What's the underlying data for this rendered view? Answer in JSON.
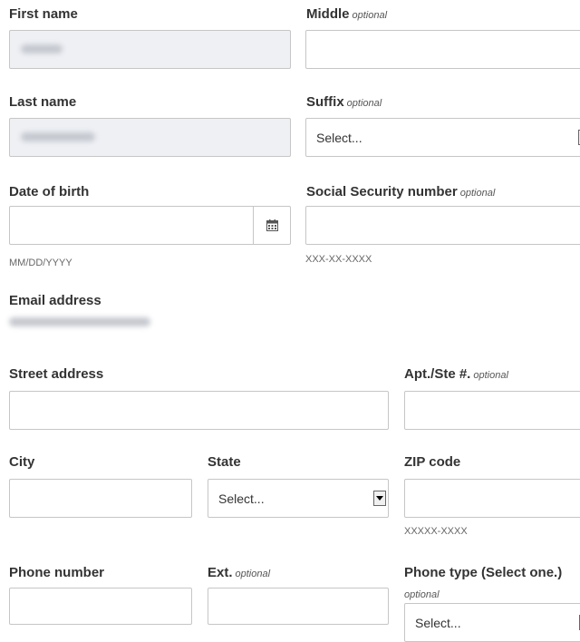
{
  "fields": {
    "first_name": {
      "label": "First name"
    },
    "middle": {
      "label": "Middle",
      "optional": "optional"
    },
    "last_name": {
      "label": "Last name"
    },
    "suffix": {
      "label": "Suffix",
      "optional": "optional",
      "selected": "Select..."
    },
    "dob": {
      "label": "Date of birth",
      "hint": "MM/DD/YYYY",
      "icon": "calendar-icon"
    },
    "ssn": {
      "label": "Social Security number",
      "optional": "optional",
      "hint": "XXX-XX-XXXX"
    },
    "email": {
      "label": "Email address"
    },
    "street": {
      "label": "Street address"
    },
    "apt": {
      "label": "Apt./Ste #.",
      "optional": "optional"
    },
    "city": {
      "label": "City"
    },
    "state": {
      "label": "State",
      "selected": "Select..."
    },
    "zip": {
      "label": "ZIP code",
      "hint": "XXXXX-XXXX"
    },
    "phone": {
      "label": "Phone number"
    },
    "ext": {
      "label": "Ext.",
      "optional": "optional"
    },
    "phone_type": {
      "label": "Phone type (Select one.)",
      "optional": "optional",
      "selected": "Select..."
    }
  },
  "colors": {
    "label": "#333333",
    "input_border": "#c6c6c6",
    "prefilled_background": "#eef0f4"
  }
}
